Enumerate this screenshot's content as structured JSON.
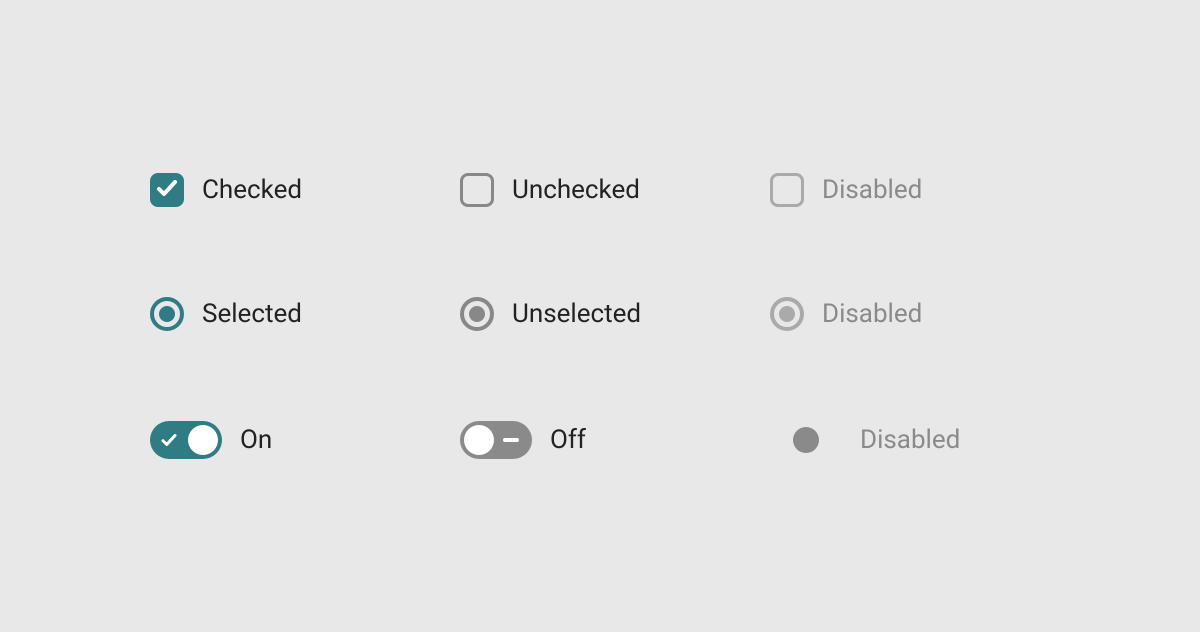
{
  "colors": {
    "accent": "#2f7c85",
    "neutral": "#888888",
    "disabled": "#aaaaaa",
    "disabledText": "#8a8a8a",
    "background": "#e8e8e8"
  },
  "checkbox": {
    "checked": {
      "label": "Checked"
    },
    "unchecked": {
      "label": "Unchecked"
    },
    "disabled": {
      "label": "Disabled"
    }
  },
  "radio": {
    "selected": {
      "label": "Selected"
    },
    "unselected": {
      "label": "Unselected"
    },
    "disabled": {
      "label": "Disabled"
    }
  },
  "switch": {
    "on": {
      "label": "On"
    },
    "off": {
      "label": "Off"
    },
    "disabled": {
      "label": "Disabled"
    }
  }
}
